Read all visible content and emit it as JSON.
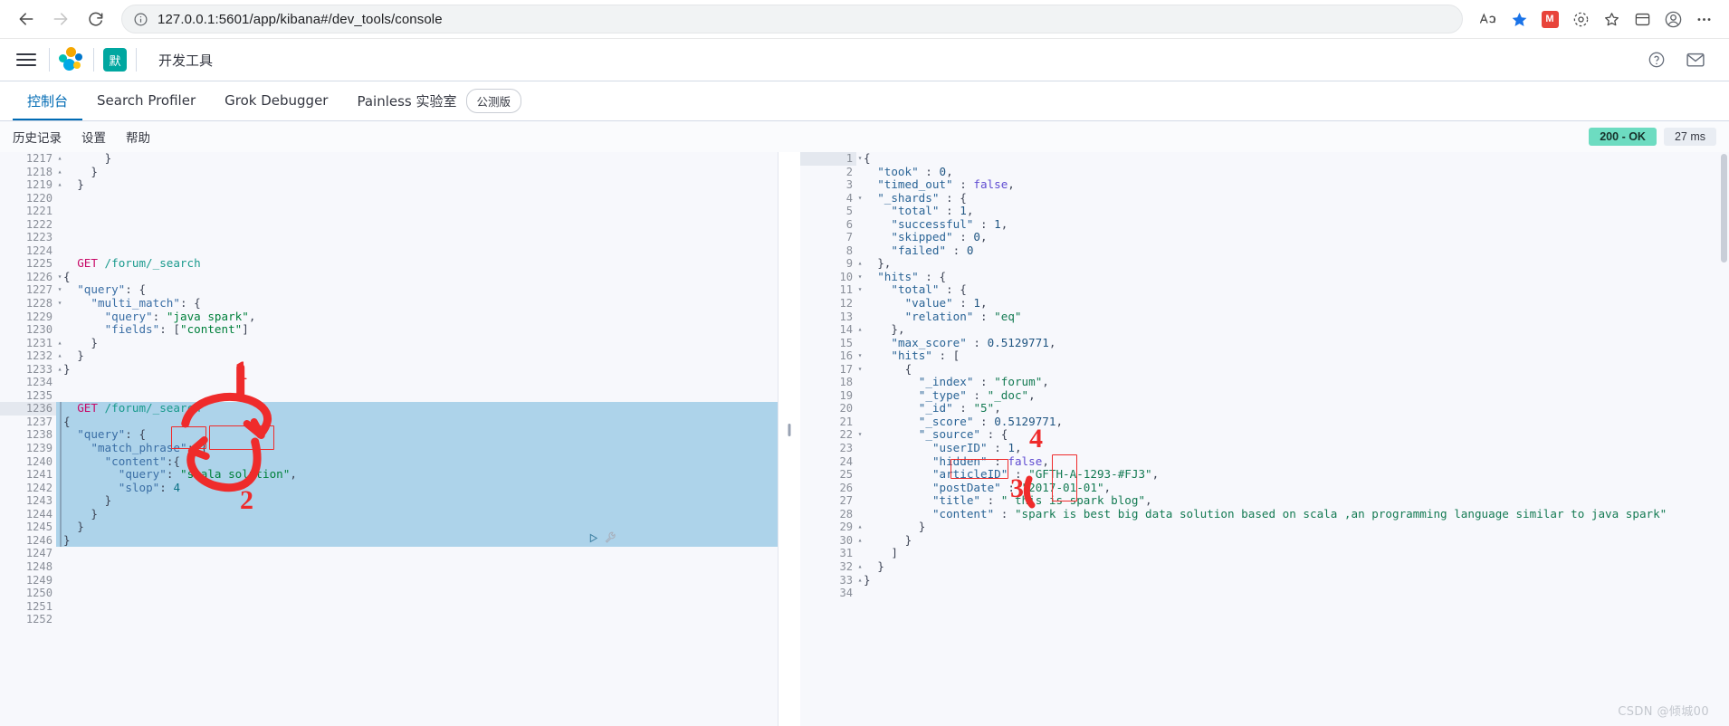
{
  "browser": {
    "url": "127.0.0.1:5601/app/kibana#/dev_tools/console",
    "back_label": "Back",
    "forward_label": "Forward",
    "reload_label": "Reload",
    "info_icon": "info-icon",
    "read_aloud_label": "A",
    "favorite_icon": "star-icon",
    "extension_badge": "M",
    "collections_icon": "collections-icon",
    "favorites_icon": "favorites-icon",
    "settings_icon": "browser-settings-icon",
    "profile_icon": "profile-icon",
    "more_icon": "more-icon"
  },
  "kibana_header": {
    "menu_icon": "hamburger-icon",
    "logo_icon": "kibana-logo",
    "space_badge": "默",
    "app_title": "开发工具",
    "help_icon": "help-icon",
    "mail_icon": "mail-icon"
  },
  "tabs": [
    {
      "label": "控制台",
      "active": true
    },
    {
      "label": "Search Profiler",
      "active": false
    },
    {
      "label": "Grok Debugger",
      "active": false
    },
    {
      "label": "Painless 实验室",
      "active": false
    }
  ],
  "beta_pill": "公测版",
  "console_toolbar": {
    "links": [
      "历史记录",
      "设置",
      "帮助"
    ],
    "status_code": "200 - OK",
    "latency": "27 ms"
  },
  "editor": {
    "play_icon": "play-request-icon",
    "wrench_icon": "wrench-icon",
    "first_line_number": 1217,
    "current_line": 1236,
    "lines": [
      {
        "n": 1217,
        "fold": "up",
        "text": "      }"
      },
      {
        "n": 1218,
        "fold": "up",
        "text": "    }"
      },
      {
        "n": 1219,
        "fold": "up",
        "text": "  }"
      },
      {
        "n": 1220,
        "fold": "",
        "text": ""
      },
      {
        "n": 1221,
        "fold": "",
        "text": ""
      },
      {
        "n": 1222,
        "fold": "",
        "text": ""
      },
      {
        "n": 1223,
        "fold": "",
        "text": ""
      },
      {
        "n": 1224,
        "fold": "",
        "text": ""
      },
      {
        "n": 1225,
        "fold": "",
        "text": "  GET /forum/_search"
      },
      {
        "n": 1226,
        "fold": "down",
        "text": "{"
      },
      {
        "n": 1227,
        "fold": "down",
        "text": "  \"query\": {"
      },
      {
        "n": 1228,
        "fold": "down",
        "text": "    \"multi_match\": {"
      },
      {
        "n": 1229,
        "fold": "",
        "text": "      \"query\": \"java spark\","
      },
      {
        "n": 1230,
        "fold": "",
        "text": "      \"fields\": [\"content\"]"
      },
      {
        "n": 1231,
        "fold": "up",
        "text": "    }"
      },
      {
        "n": 1232,
        "fold": "up",
        "text": "  }"
      },
      {
        "n": 1233,
        "fold": "up",
        "text": "}"
      },
      {
        "n": 1234,
        "fold": "",
        "text": ""
      },
      {
        "n": 1235,
        "fold": "",
        "text": ""
      },
      {
        "n": 1236,
        "fold": "",
        "text": "  GET /forum/_search"
      },
      {
        "n": 1237,
        "fold": "down",
        "text": "{"
      },
      {
        "n": 1238,
        "fold": "down",
        "text": "  \"query\": {"
      },
      {
        "n": 1239,
        "fold": "down",
        "text": "    \"match_phrase\": {"
      },
      {
        "n": 1240,
        "fold": "down",
        "text": "      \"content\":{"
      },
      {
        "n": 1241,
        "fold": "",
        "text": "        \"query\": \"scala solution\","
      },
      {
        "n": 1242,
        "fold": "",
        "text": "        \"slop\": 4"
      },
      {
        "n": 1243,
        "fold": "up",
        "text": "      }"
      },
      {
        "n": 1244,
        "fold": "up",
        "text": "    }"
      },
      {
        "n": 1245,
        "fold": "up",
        "text": "  }"
      },
      {
        "n": 1246,
        "fold": "up",
        "text": "}"
      },
      {
        "n": 1247,
        "fold": "",
        "text": ""
      },
      {
        "n": 1248,
        "fold": "",
        "text": ""
      },
      {
        "n": 1249,
        "fold": "",
        "text": ""
      },
      {
        "n": 1250,
        "fold": "",
        "text": ""
      },
      {
        "n": 1251,
        "fold": "",
        "text": ""
      },
      {
        "n": 1252,
        "fold": "",
        "text": ""
      }
    ],
    "request_method": "GET",
    "request_path": "/forum/_search",
    "match_phrase_query_value": "scala solution",
    "slop_value": 4,
    "multi_match_query_value": "java spark",
    "multi_match_fields": "[\"content\"]"
  },
  "response": {
    "lines": [
      {
        "n": 1,
        "fold": "down",
        "text": "{"
      },
      {
        "n": 2,
        "fold": "",
        "text": "  \"took\" : 0,"
      },
      {
        "n": 3,
        "fold": "",
        "text": "  \"timed_out\" : false,"
      },
      {
        "n": 4,
        "fold": "down",
        "text": "  \"_shards\" : {"
      },
      {
        "n": 5,
        "fold": "",
        "text": "    \"total\" : 1,"
      },
      {
        "n": 6,
        "fold": "",
        "text": "    \"successful\" : 1,"
      },
      {
        "n": 7,
        "fold": "",
        "text": "    \"skipped\" : 0,"
      },
      {
        "n": 8,
        "fold": "",
        "text": "    \"failed\" : 0"
      },
      {
        "n": 9,
        "fold": "up",
        "text": "  },"
      },
      {
        "n": 10,
        "fold": "down",
        "text": "  \"hits\" : {"
      },
      {
        "n": 11,
        "fold": "down",
        "text": "    \"total\" : {"
      },
      {
        "n": 12,
        "fold": "",
        "text": "      \"value\" : 1,"
      },
      {
        "n": 13,
        "fold": "",
        "text": "      \"relation\" : \"eq\""
      },
      {
        "n": 14,
        "fold": "up",
        "text": "    },"
      },
      {
        "n": 15,
        "fold": "",
        "text": "    \"max_score\" : 0.5129771,"
      },
      {
        "n": 16,
        "fold": "down",
        "text": "    \"hits\" : ["
      },
      {
        "n": 17,
        "fold": "down",
        "text": "      {"
      },
      {
        "n": 18,
        "fold": "",
        "text": "        \"_index\" : \"forum\","
      },
      {
        "n": 19,
        "fold": "",
        "text": "        \"_type\" : \"_doc\","
      },
      {
        "n": 20,
        "fold": "",
        "text": "        \"_id\" : \"5\","
      },
      {
        "n": 21,
        "fold": "",
        "text": "        \"_score\" : 0.5129771,"
      },
      {
        "n": 22,
        "fold": "down",
        "text": "        \"_source\" : {"
      },
      {
        "n": 23,
        "fold": "",
        "text": "          \"userID\" : 1,"
      },
      {
        "n": 24,
        "fold": "",
        "text": "          \"hidden\" : false,"
      },
      {
        "n": 25,
        "fold": "",
        "text": "          \"articleID\" : \"GFTH-A-1293-#FJ3\","
      },
      {
        "n": 26,
        "fold": "",
        "text": "          \"postDate\" : \"2017-01-01\","
      },
      {
        "n": 27,
        "fold": "",
        "text": "          \"title\" : \" this is spark blog\","
      },
      {
        "n": 28,
        "fold": "",
        "text": "          \"content\" : \"spark is best big data solution based on scala ,an programming language similar to java spark\""
      },
      {
        "n": 29,
        "fold": "up",
        "text": "        }"
      },
      {
        "n": 30,
        "fold": "up",
        "text": "      }"
      },
      {
        "n": 31,
        "fold": "",
        "text": "    ]"
      },
      {
        "n": 32,
        "fold": "up",
        "text": "  }"
      },
      {
        "n": 33,
        "fold": "up",
        "text": "}"
      },
      {
        "n": 34,
        "fold": "",
        "text": ""
      }
    ],
    "took": 0,
    "timed_out": "false",
    "shards_total": 1,
    "shards_successful": 1,
    "shards_skipped": 0,
    "shards_failed": 0,
    "hits_total_value": 1,
    "hits_total_relation": "eq",
    "max_score": 0.5129771,
    "hit_index": "forum",
    "hit_type": "_doc",
    "hit_id": "5",
    "hit_score": 0.5129771,
    "source_userID": 1,
    "source_hidden": "false",
    "source_articleID": "GFTH-A-1293-#FJ3",
    "source_postDate": "2017-01-01",
    "source_title": " this is spark blog",
    "source_content": "spark is best big data solution based on scala ,an programming language similar to java spark"
  },
  "annotations": {
    "markers": [
      "1",
      "2",
      "3",
      "4"
    ],
    "highlighted_terms": [
      "scala",
      "solution",
      "solution",
      "scala"
    ],
    "accent_color": "#ef2b2b"
  },
  "watermark": "CSDN @倾城00"
}
